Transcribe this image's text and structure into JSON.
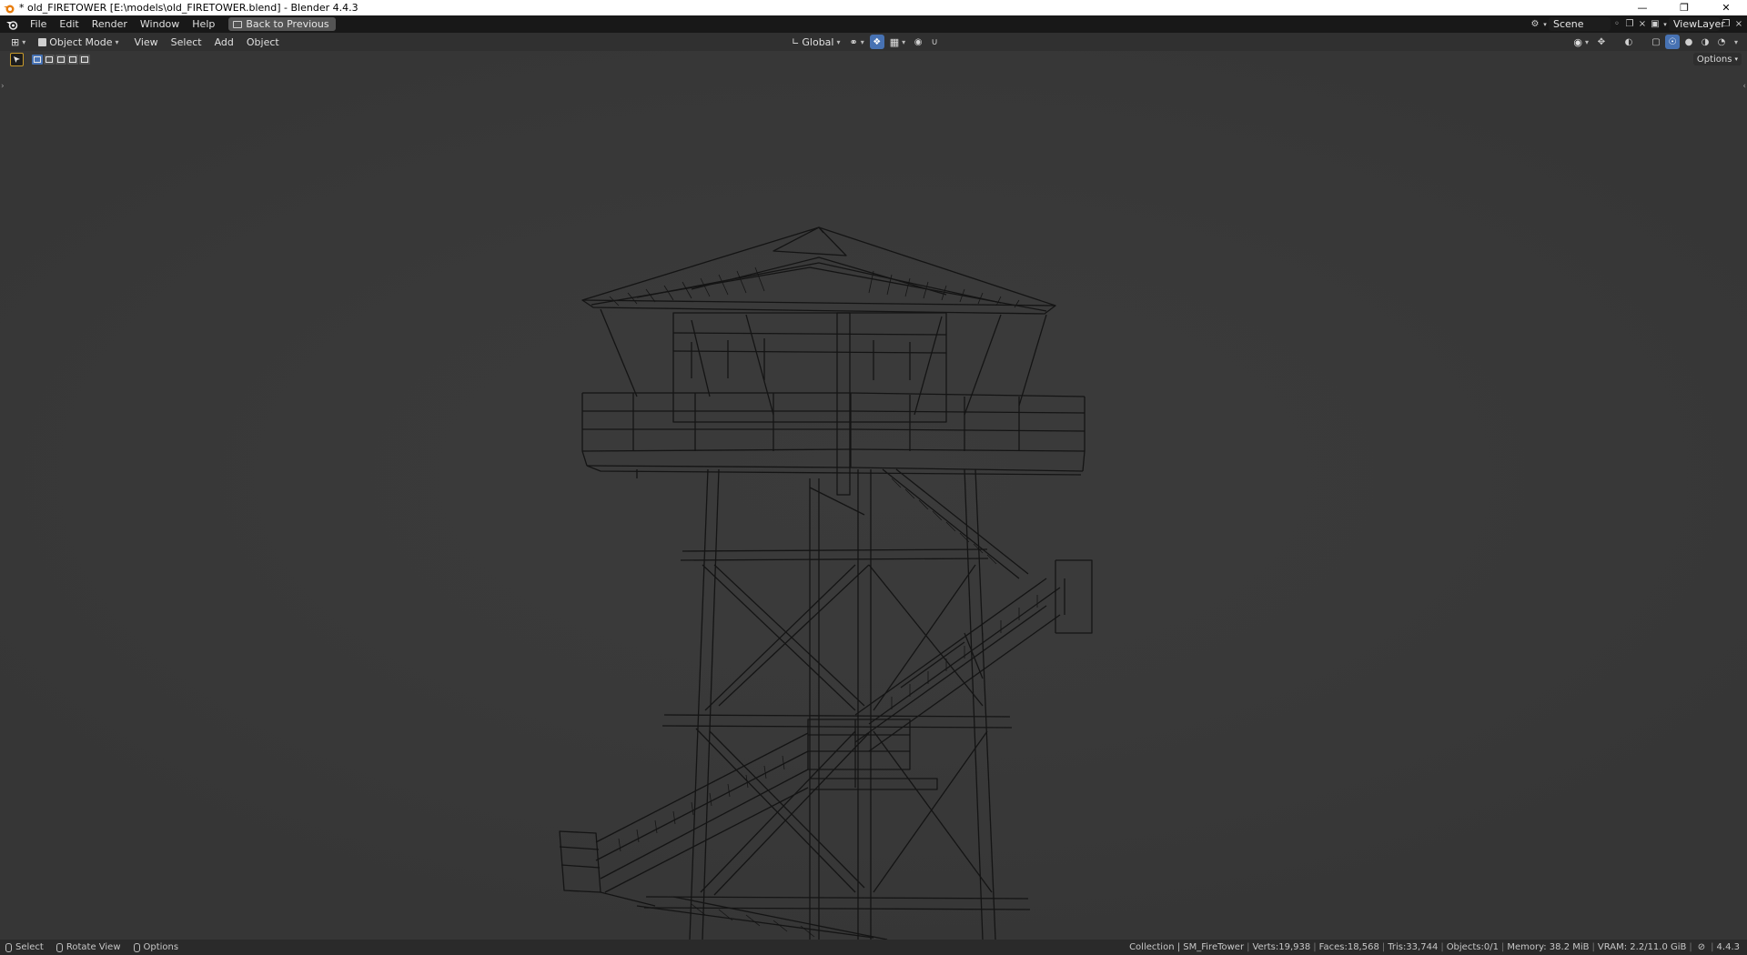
{
  "window": {
    "title": "* old_FIRETOWER [E:\\models\\old_FIRETOWER.blend] - Blender 4.4.3",
    "controls": [
      "minimize",
      "restore",
      "close"
    ]
  },
  "topbar": {
    "menus": [
      "File",
      "Edit",
      "Render",
      "Window",
      "Help"
    ],
    "back_button": "Back to Previous",
    "scene": "Scene",
    "view_layer": "ViewLayer"
  },
  "viewport_header": {
    "editor_type_icon": "3d-viewport-icon",
    "mode": "Object Mode",
    "menus": [
      "View",
      "Select",
      "Add",
      "Object"
    ],
    "transform_orientation": "Global",
    "shading_modes": [
      "wireframe",
      "solid",
      "material-preview",
      "rendered"
    ],
    "active_shading": "wireframe",
    "options_label": "Options"
  },
  "tool_settings": {
    "active_tool": "select-box-icon",
    "selection_modes": [
      "set",
      "extend",
      "subtract",
      "difference",
      "intersect"
    ],
    "active_mode": "set"
  },
  "statusbar": {
    "hints": [
      {
        "icon": "mouse-left-icon",
        "label": "Select"
      },
      {
        "icon": "mouse-middle-icon",
        "label": "Rotate View"
      },
      {
        "icon": "mouse-right-icon",
        "label": "Options"
      }
    ],
    "collection": "Collection | SM_FireTower",
    "verts": "Verts:19,938",
    "faces": "Faces:18,568",
    "tris": "Tris:33,744",
    "objects": "Objects:0/1",
    "memory": "Memory: 38.2 MiB",
    "vram": "VRAM: 2.2/11.0 GiB",
    "version": "4.4.3"
  },
  "colors": {
    "accent": "#4772b3",
    "viewport_bg": "#393939",
    "wire": "#141414",
    "tool_outline": "#c79a2a"
  }
}
